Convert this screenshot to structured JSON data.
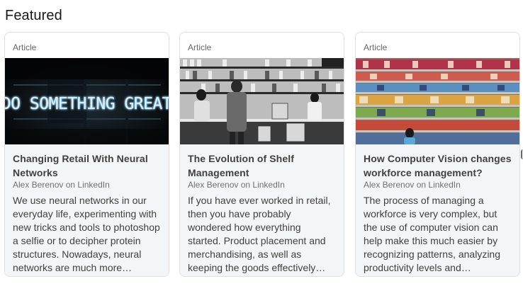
{
  "section": {
    "title": "Featured"
  },
  "cards": [
    {
      "type": "Article",
      "image_label": "DO SOMETHING GREAT",
      "title": "Changing Retail With Neural Networks",
      "author": "Alex Berenov on LinkedIn",
      "description": "We use neural networks in our everyday life, experimenting with new tricks and tools to photoshop a selfie or to decipher protein structures. Nowadays, neural networks are much more…"
    },
    {
      "type": "Article",
      "title": "The Evolution of Shelf Management",
      "author": "Alex Berenov on LinkedIn",
      "description": "If you have ever worked in retail, then you have probably wondered how everything started. Product placement and merchandising, as well as keeping the goods effectively…"
    },
    {
      "type": "Article",
      "title": "How Computer Vision changes workforce management?",
      "author": "Alex Berenov on LinkedIn",
      "description": "The process of managing a workforce is very complex, but the use of computer vision can help make this much easier by recognizing patterns, analyzing productivity levels and…"
    }
  ]
}
